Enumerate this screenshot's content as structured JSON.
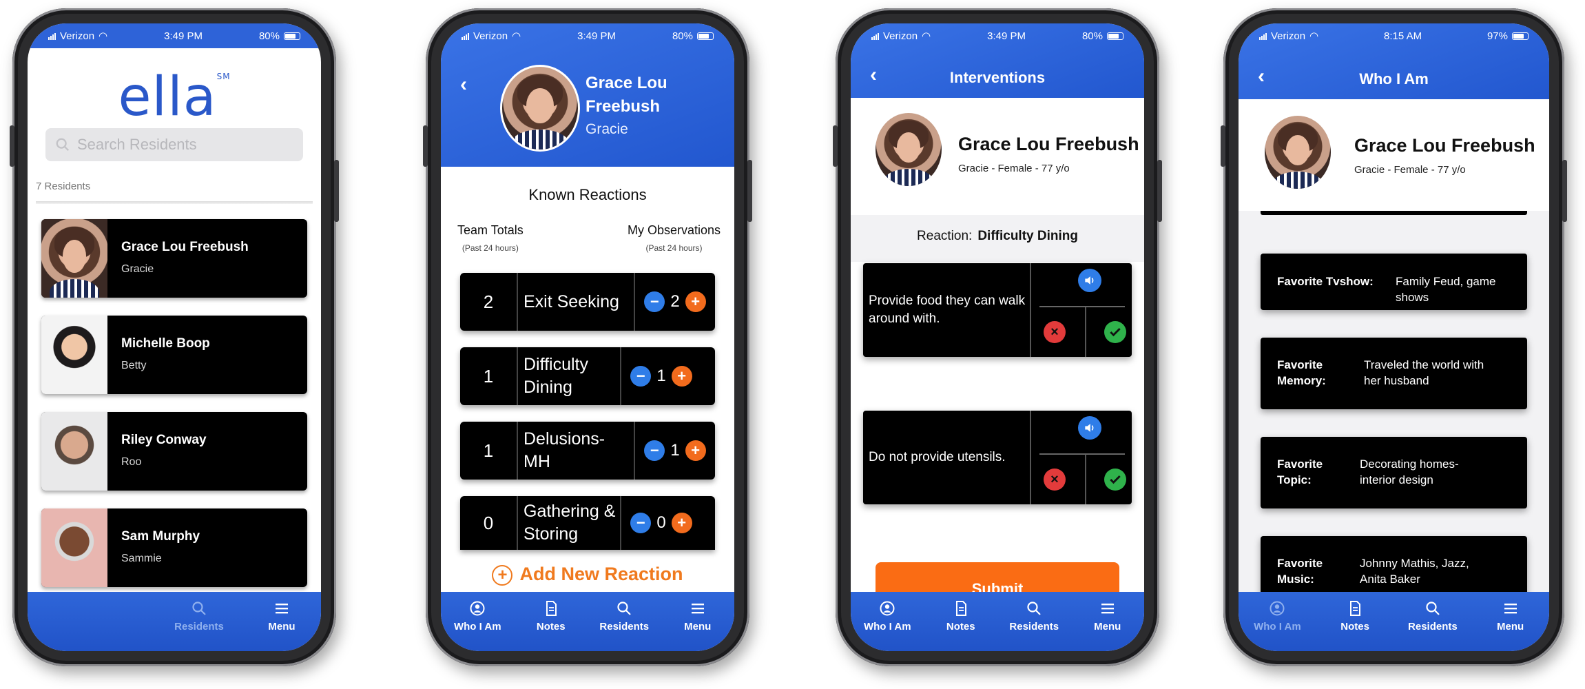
{
  "phones": [
    {
      "status": {
        "carrier": "Verizon",
        "time": "3:49 PM",
        "battery": "80%"
      },
      "logo": "ella",
      "logo_mark": "SM",
      "search": {
        "placeholder": "Search Residents"
      },
      "residents_count": "7 Residents",
      "residents": [
        {
          "name": "Grace Lou Freebush",
          "nickname": "Gracie"
        },
        {
          "name": "Michelle Boop",
          "nickname": "Betty"
        },
        {
          "name": "Riley Conway",
          "nickname": "Roo"
        },
        {
          "name": "Sam Murphy",
          "nickname": "Sammie"
        }
      ],
      "tabs": [
        {
          "label": "Residents",
          "icon": "search-icon"
        },
        {
          "label": "Menu",
          "icon": "menu-icon"
        }
      ]
    },
    {
      "status": {
        "carrier": "Verizon",
        "time": "3:49 PM",
        "battery": "80%"
      },
      "profile": {
        "name": "Grace Lou Freebush",
        "nickname": "Gracie"
      },
      "section_title": "Known Reactions",
      "team_totals": {
        "label": "Team Totals",
        "sub": "(Past 24 hours)"
      },
      "my_observations": {
        "label": "My Observations",
        "sub": "(Past 24 hours)"
      },
      "reactions": [
        {
          "total": "2",
          "label": "Exit Seeking",
          "mine": "2"
        },
        {
          "total": "1",
          "label": "Difficulty Dining",
          "mine": "1"
        },
        {
          "total": "1",
          "label": "Delusions- MH",
          "mine": "1"
        },
        {
          "total": "0",
          "label": "Gathering & Storing",
          "mine": "0"
        }
      ],
      "minus_symbol": "−",
      "plus_symbol": "+",
      "add_reaction": "Add New Reaction",
      "tabs": [
        {
          "label": "Who I Am",
          "icon": "person-icon"
        },
        {
          "label": "Notes",
          "icon": "notes-icon"
        },
        {
          "label": "Residents",
          "icon": "search-icon"
        },
        {
          "label": "Menu",
          "icon": "menu-icon"
        }
      ]
    },
    {
      "status": {
        "carrier": "Verizon",
        "time": "3:49 PM",
        "battery": "80%"
      },
      "title": "Interventions",
      "profile": {
        "name": "Grace Lou Freebush",
        "meta": "Gracie - Female - 77 y/o"
      },
      "reaction_label": "Reaction:",
      "reaction_value": "Difficulty Dining",
      "interventions": [
        {
          "text": "Provide food they can walk around with."
        },
        {
          "text": "Do not provide utensils."
        }
      ],
      "reject_symbol": "×",
      "submit": "Submit",
      "tabs": [
        {
          "label": "Who I Am",
          "icon": "person-icon"
        },
        {
          "label": "Notes",
          "icon": "notes-icon"
        },
        {
          "label": "Residents",
          "icon": "search-icon"
        },
        {
          "label": "Menu",
          "icon": "menu-icon"
        }
      ]
    },
    {
      "status": {
        "carrier": "Verizon",
        "time": "8:15 AM",
        "battery": "97%"
      },
      "title": "Who I Am",
      "profile": {
        "name": "Grace Lou Freebush",
        "meta": "Gracie - Female - 77 y/o"
      },
      "favorites": [
        {
          "key": "Favorite Tvshow:",
          "value": "Family Feud, game shows"
        },
        {
          "key": "Favorite Memory:",
          "value": "Traveled the world with her husband"
        },
        {
          "key": "Favorite Topic:",
          "value": "Decorating homes- interior design"
        },
        {
          "key": "Favorite Music:",
          "value": "Johnny Mathis, Jazz, Anita Baker"
        }
      ],
      "tabs": [
        {
          "label": "Who I Am",
          "icon": "person-icon"
        },
        {
          "label": "Notes",
          "icon": "notes-icon"
        },
        {
          "label": "Residents",
          "icon": "search-icon"
        },
        {
          "label": "Menu",
          "icon": "menu-icon"
        }
      ]
    }
  ],
  "colors": {
    "brand_blue": "#2e63d8",
    "accent_orange": "#fa6c14",
    "minus_blue": "#2f7de8",
    "reject_red": "#e23b3b",
    "accept_green": "#2fb24b"
  }
}
